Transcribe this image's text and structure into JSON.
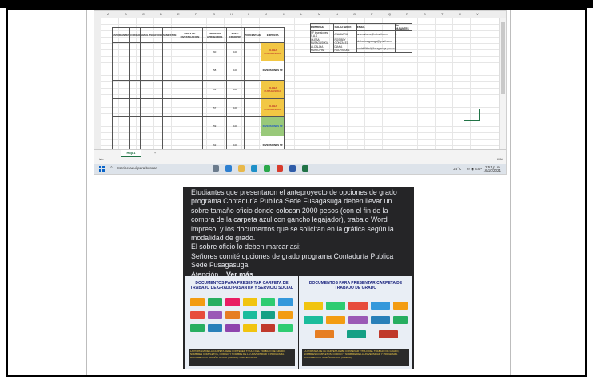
{
  "excel": {
    "columns": [
      "A",
      "B",
      "C",
      "D",
      "E",
      "F",
      "G",
      "H",
      "I",
      "J",
      "K",
      "L",
      "M",
      "N",
      "O",
      "P",
      "Q",
      "R",
      "S",
      "T",
      "U",
      "V"
    ],
    "left_table": {
      "headers": [
        "ESTUDIANTES",
        "CODIGO",
        "EMAIL",
        "TELEFONO",
        "SEMESTRE",
        "LINEA DE INVESTIGACION",
        "CREDITOS APROBADOS",
        "TOTAL CREDITOS",
        "PORCENTAJE",
        "EMPRESA"
      ],
      "rows": [
        {
          "empresa": "OLEBA FUSAGASUGA",
          "status": "yellow",
          "pct": "100",
          "rep": "60"
        },
        {
          "empresa": "INVERSIONES SF",
          "status": "white",
          "pct": "100",
          "rep": "58"
        },
        {
          "empresa": "OLEBA FUSAGASUGA",
          "status": "yellow",
          "pct": "100",
          "rep": "61"
        },
        {
          "empresa": "OLEBA FUSAGASUGA",
          "status": "yellow",
          "pct": "100",
          "rep": "57"
        },
        {
          "empresa": "INVERSIONES SF",
          "status": "green",
          "pct": "100",
          "rep": "59"
        },
        {
          "empresa": "INVERSIONES SF",
          "status": "white",
          "pct": "100",
          "rep": "62"
        }
      ]
    },
    "right_table": {
      "headers": [
        "EMPRESA",
        "SOLICITANTE",
        "EMAIL",
        "No. PASANTES"
      ],
      "rows": [
        [
          "SF inversiones S.A.S",
          "ANA MARIA",
          "anamariainv@hotmail.com",
          "3"
        ],
        [
          "OLEBA FUSAGASUGA",
          "ROSIBEY GONZALEZ",
          "oleba.fusagasuga@gmail.com",
          "3"
        ],
        [
          "ALCALDIA MUNICIPAL",
          "DIANA RODRIGUEZ",
          "contabilidad@fusagasuga.gov.co",
          "2"
        ]
      ]
    },
    "sheet_tab": "Hoja1",
    "add_sheet": "+",
    "status_left": "Listo",
    "zoom": "60%",
    "taskbar": {
      "search_placeholder": "Escribe aquí para buscar",
      "weather": "26°C",
      "lang": "ESP",
      "time": "2:51 p. m.",
      "date": "16/10/2021"
    }
  },
  "post": {
    "paragraph1": "Etudiantes que presentaron el anteproyecto de opciones de grado programa Contaduría Publica Sede Fusagasuga deben llevar un sobre tamaño oficio donde colocan 2000 pesos (con el fin de la compra de la carpeta azul con gancho legajador), trabajo Word impreso, y los documentos que se solicitan en la gráfica según la modalidad de grado.",
    "paragraph2": "El sobre oficio lo deben marcar asi:",
    "paragraph3": "Señores comité opciones de grado programa Contaduría Publica Sede Fusagasuga",
    "paragraph4_prefix": "Atención...",
    "see_more": "Ver más",
    "image_left_title": "DOCUMENTOS PARA PRESENTAR CARPETA DE TRABAJO DE GRADO PASANTIA Y SERVICIO SOCIAL",
    "image_right_title": "DOCUMENTOS PARA PRESENTAR CARPETA DE TRABAJO DE GRADO",
    "image_left_notes": "LA PORTADA DE LA CARPETA DEBE CONTENER TITULO DEL TRABAJO DE GRADO, NOMBRES COMPLETOS, CODIGO Y NOMBRE DE LA UNIVERSIDAD Y PROGRAMA. DOCUMENTOS TAMAÑO OFICIO (CREMA). CARPETA AZUL",
    "image_right_notes": "LA PORTADA DE LA CARPETA DEBE CONTENER TITULO DEL TRABAJO DE GRADO, NOMBRES COMPLETOS, CODIGO Y NOMBRE DE LA UNIVERSIDAD Y PROGRAMA. DOCUMENTOS TAMAÑO OFICIO (CREMA)."
  }
}
